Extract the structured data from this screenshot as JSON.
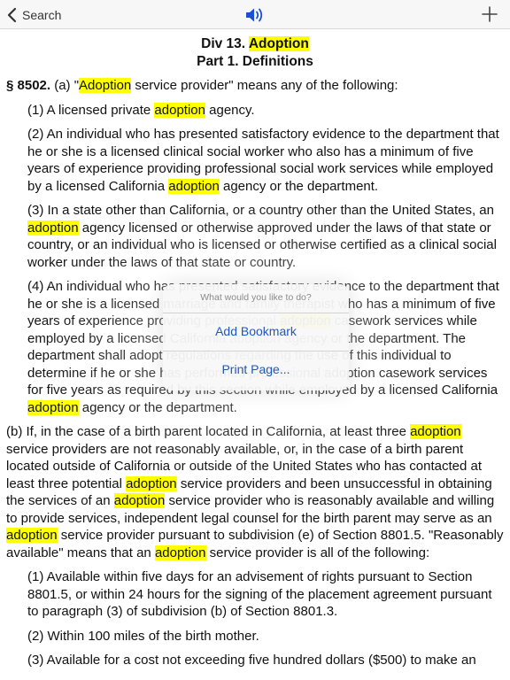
{
  "nav": {
    "back_label": "Search",
    "back_icon": "chevron-left-icon",
    "audio_icon": "speaker-icon",
    "add_icon": "plus-icon"
  },
  "heading": {
    "line1_prefix": "Div 13. ",
    "line1_highlight": "Adoption",
    "line2": "Part 1. Definitions"
  },
  "section": {
    "number": "§ 8502.",
    "intro_pre": " (a) \"",
    "intro_hl": "Adoption",
    "intro_post": " service provider\" means any of the following:"
  },
  "items": {
    "i1": {
      "pre": "(1) A licensed private ",
      "hl": "adoption",
      "post": " agency."
    },
    "i2": {
      "pre": "(2) An individual who has presented satisfactory evidence to the department that he or she is a licensed clinical social worker who also has a minimum of five years of experience providing professional social work services while employed by a licensed California ",
      "hl": "adoption",
      "post": " agency or the department."
    },
    "i3": {
      "pre": "(3) In a state other than California, or a country other than the United States, an ",
      "hl": "adoption",
      "post": " agency licensed or otherwise approved under the laws of that state or country, or an individual who is licensed or otherwise certified as a clinical social worker under the laws of that state or country."
    },
    "i4": {
      "pre": "(4) An individual who has presented satisfactory evidence to the department that he or she is a licensed marriage and family therapist who has a minimum of five years of experience providing professional ",
      "hl1": "adoption",
      "mid": " casework services while employed by a licensed California adoption agency or the department. The department shall adopt regulations regarding the use of this individual to determine if he or she has performed professional adoption casework services for five years as required by this section while employed by a licensed California ",
      "hl2": "adoption",
      "post": " agency or the department."
    }
  },
  "para_b": {
    "t1": "(b) If, in the case of a birth parent located in California, at least three ",
    "h1": "adoption",
    "t2": " service providers are not reasonably available, or, in the case of a birth parent located outside of California or outside of the United States who has contacted at least three potential ",
    "h2": "adoption",
    "t3": " service providers and been unsuccessful in obtaining the services of an ",
    "h3": "adoption",
    "t4": " service provider who is reasonably available and willing to provide services, independent legal counsel for the birth parent may serve as an ",
    "h4": "adoption",
    "t5": " service provider pursuant to subdivision (e) of Section 8801.5. \"Reasonably available\" means that an ",
    "h5": "adoption",
    "t6": " service provider is all of the following:"
  },
  "b_items": {
    "b1": "(1) Available within five days for an advisement of rights pursuant to Section 8801.5, or within 24 hours for the signing of the placement agreement pursuant to paragraph (3) of subdivision (b) of Section 8801.3.",
    "b2": "(2) Within 100 miles of the birth mother.",
    "b3": "(3) Available for a cost not exceeding five hundred dollars ($500) to make an"
  },
  "popover": {
    "title": "What would you like to do?",
    "add_bookmark": "Add Bookmark",
    "print_page": "Print Page..."
  },
  "colors": {
    "highlight": "#ffff00",
    "link_blue": "#1f57c4",
    "audio_blue": "#1a4fd6"
  }
}
